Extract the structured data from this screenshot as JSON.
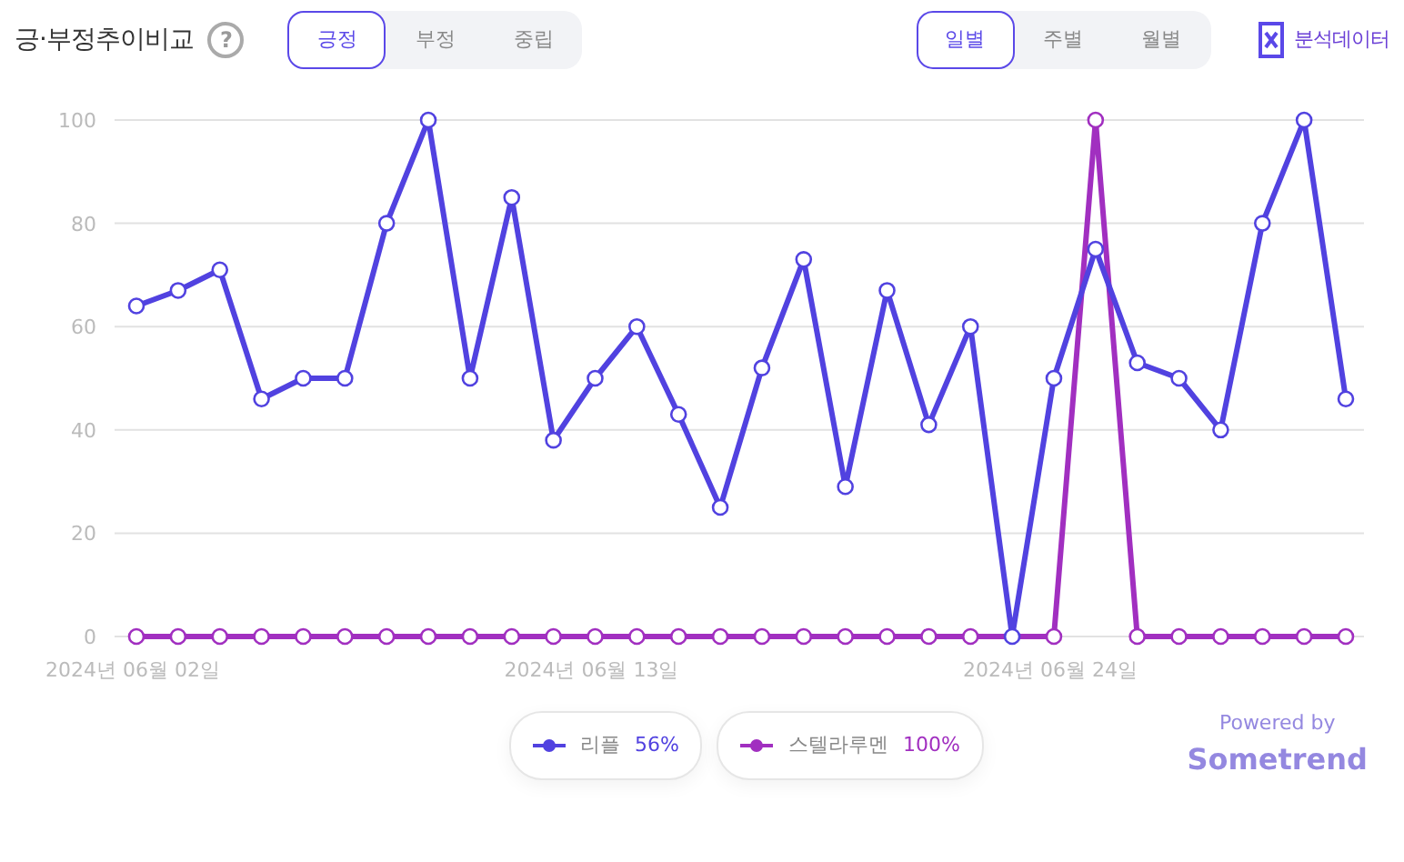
{
  "header": {
    "title": "긍·부정추이비교",
    "help": "?",
    "sentiment_tabs": [
      {
        "label": "긍정",
        "selected": true
      },
      {
        "label": "부정",
        "selected": false
      },
      {
        "label": "중립",
        "selected": false
      }
    ],
    "period_tabs": [
      {
        "label": "일별",
        "selected": true
      },
      {
        "label": "주별",
        "selected": false
      },
      {
        "label": "월별",
        "selected": false
      }
    ],
    "export_button": "분석데이터"
  },
  "chart": {
    "chart_data": {
      "type": "line",
      "categories": [
        "2024년 06월 02일",
        null,
        null,
        null,
        null,
        null,
        null,
        null,
        null,
        null,
        null,
        "2024년 06월 13일",
        null,
        null,
        null,
        null,
        null,
        null,
        null,
        null,
        null,
        null,
        "2024년 06월 24일",
        null,
        null,
        null,
        null,
        null,
        null,
        null
      ],
      "ylim": [
        0,
        100
      ],
      "grid": true,
      "yticks": [
        0,
        20,
        40,
        60,
        80,
        100
      ],
      "series": [
        {
          "name": "리플",
          "color": "#5142e0",
          "marker": "circle",
          "values": [
            64,
            67,
            71,
            46,
            50,
            50,
            80,
            100,
            50,
            85,
            38,
            50,
            60,
            43,
            25,
            52,
            73,
            29,
            67,
            41,
            60,
            0,
            50,
            75,
            53,
            50,
            40,
            80,
            100,
            46
          ]
        },
        {
          "name": "스텔라루멘",
          "color": "#a12fc0",
          "marker": "circle",
          "values": [
            0,
            0,
            0,
            0,
            0,
            0,
            0,
            0,
            0,
            0,
            0,
            0,
            0,
            0,
            0,
            0,
            0,
            0,
            0,
            0,
            0,
            0,
            0,
            100,
            0,
            0,
            0,
            0,
            0,
            0
          ]
        }
      ]
    }
  },
  "legend": [
    {
      "share": "56%"
    },
    {
      "share": "100%"
    }
  ],
  "branding": {
    "line1": "Powered by",
    "line2": "Sometrend"
  }
}
